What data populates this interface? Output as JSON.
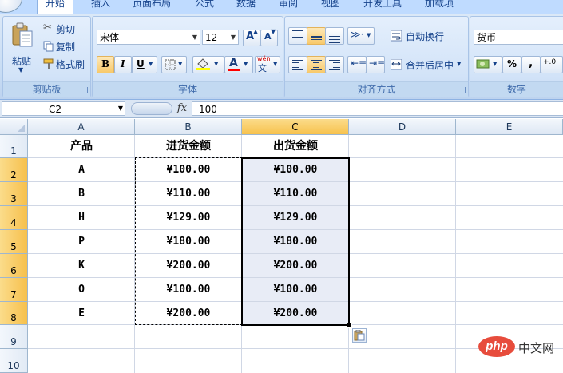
{
  "tabs": [
    "开始",
    "插入",
    "页面布局",
    "公式",
    "数据",
    "审阅",
    "视图",
    "开发工具",
    "加载项"
  ],
  "ribbon": {
    "clipboard": {
      "title": "剪贴板",
      "paste": "粘贴",
      "cut": "剪切",
      "copy": "复制",
      "format_painter": "格式刷"
    },
    "font": {
      "title": "字体",
      "font_name": "宋体",
      "font_size": "12",
      "bold": "B",
      "italic": "I",
      "underline": "U",
      "font_color": "A",
      "phonetic": "wén",
      "phonetic2": "文"
    },
    "alignment": {
      "title": "对齐方式",
      "wrap_text": "自动换行",
      "merge_center": "合并后居中"
    },
    "number": {
      "title": "数字",
      "format": "货币",
      "percent": "%",
      "comma": ",",
      "decimals": "+.0"
    }
  },
  "formula_bar": {
    "name_box": "C2",
    "fx": "fx",
    "value": "100"
  },
  "sheet": {
    "columns": [
      "A",
      "B",
      "C",
      "D",
      "E"
    ],
    "rows": [
      "1",
      "2",
      "3",
      "4",
      "5",
      "6",
      "7",
      "8",
      "9",
      "10"
    ],
    "headers": [
      "产品",
      "进货金额",
      "出货金额"
    ],
    "data": [
      [
        "A",
        "¥100.00",
        "¥100.00"
      ],
      [
        "B",
        "¥110.00",
        "¥110.00"
      ],
      [
        "H",
        "¥129.00",
        "¥129.00"
      ],
      [
        "P",
        "¥180.00",
        "¥180.00"
      ],
      [
        "K",
        "¥200.00",
        "¥200.00"
      ],
      [
        "O",
        "¥100.00",
        "¥100.00"
      ],
      [
        "E",
        "¥200.00",
        "¥200.00"
      ]
    ]
  },
  "watermark": {
    "logo": "php",
    "text": "中文网"
  }
}
